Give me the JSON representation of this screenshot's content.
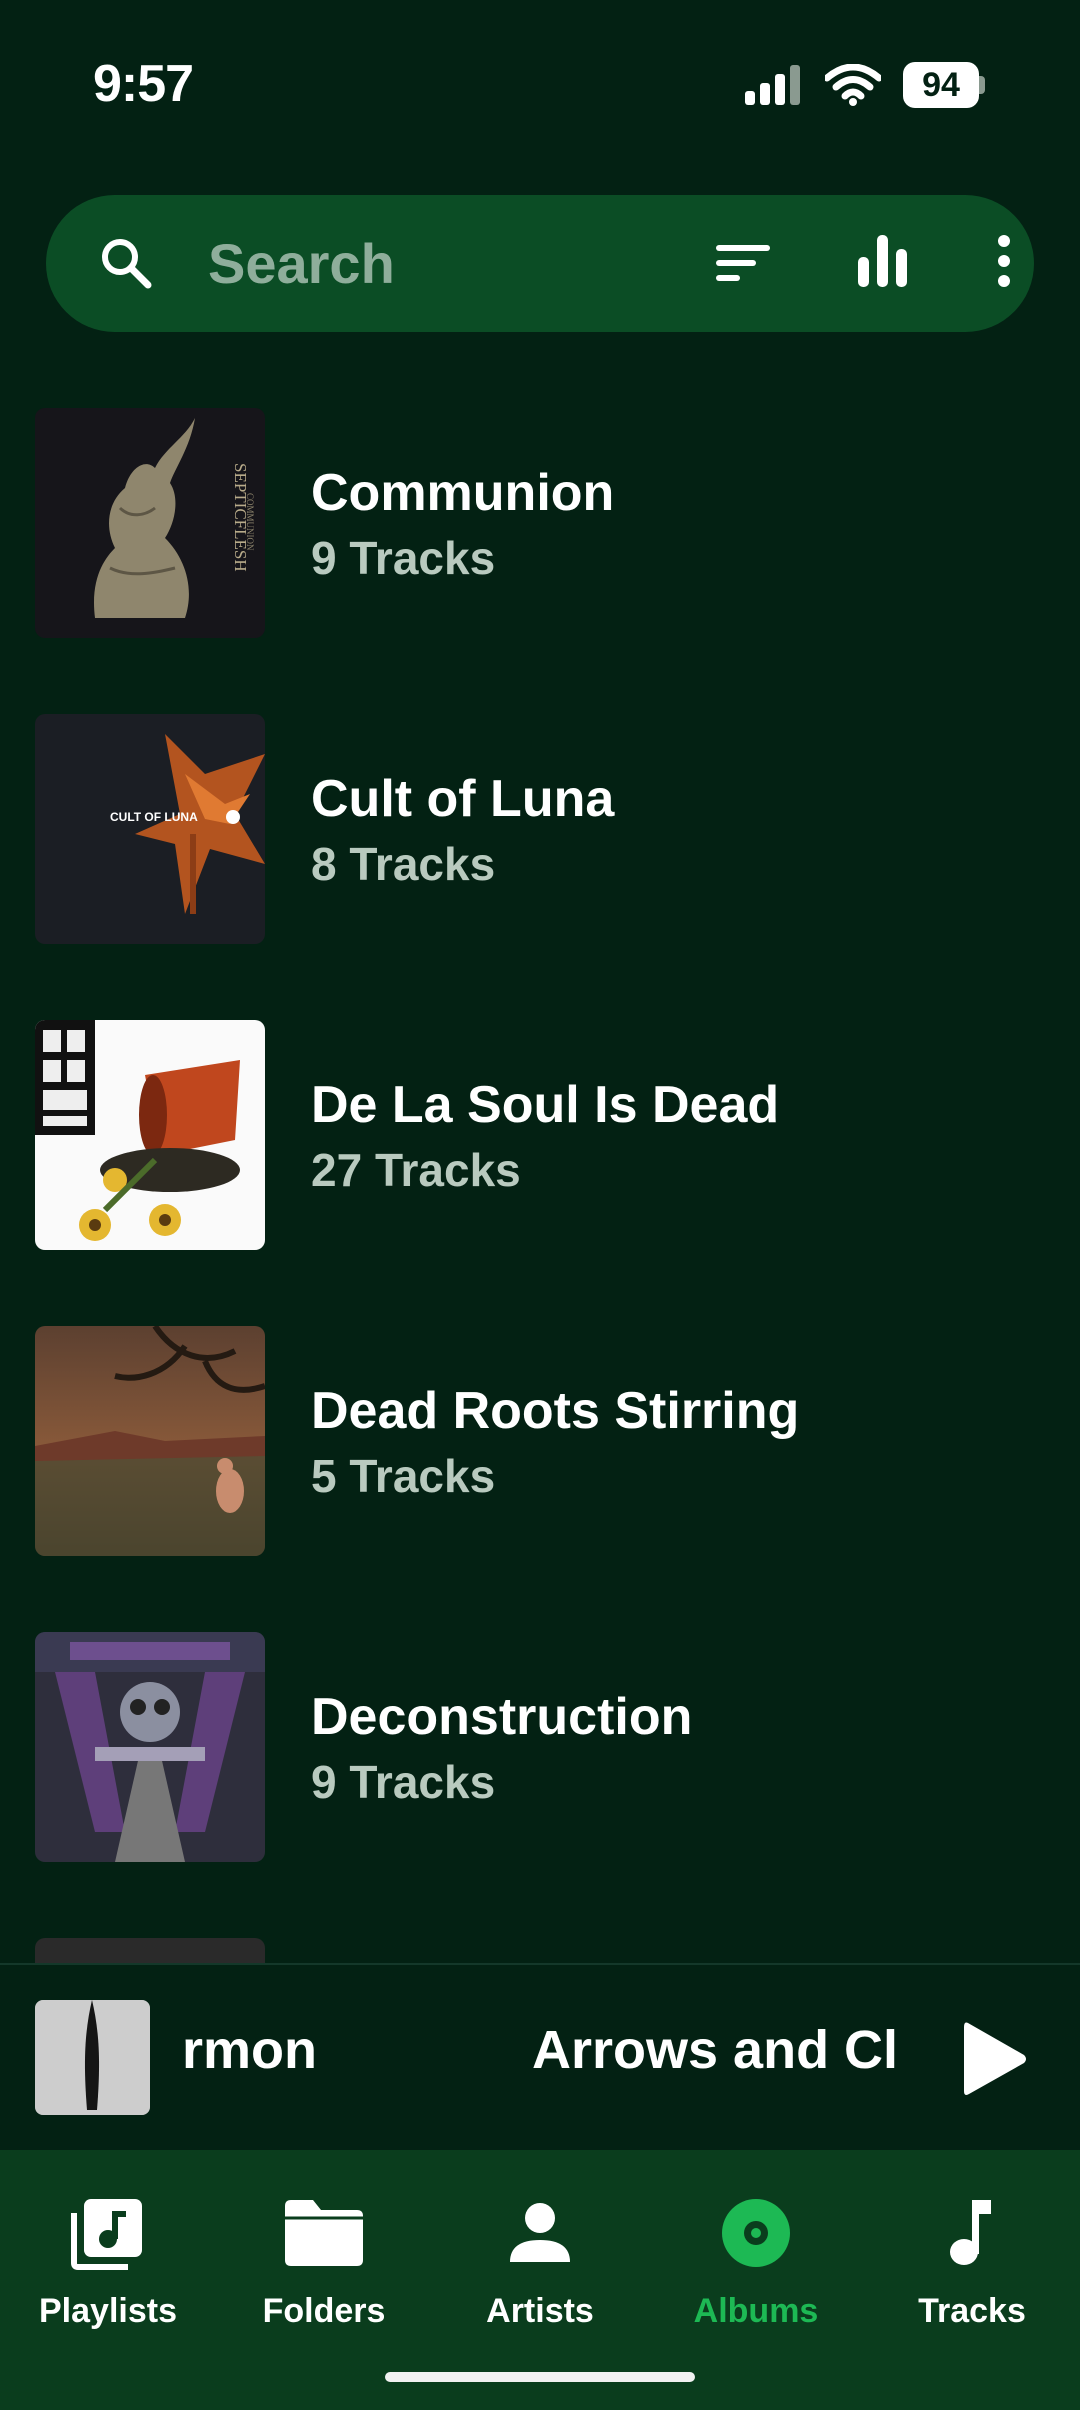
{
  "status_bar": {
    "time": "9:57",
    "battery": "94"
  },
  "search": {
    "placeholder": "Search",
    "icons": [
      "search-icon",
      "sort-icon",
      "equalizer-icon",
      "more-vert-icon"
    ]
  },
  "albums": [
    {
      "title": "Communion",
      "tracks": "9 Tracks"
    },
    {
      "title": "Cult of Luna",
      "tracks": "8 Tracks"
    },
    {
      "title": "De La Soul Is Dead",
      "tracks": "27 Tracks"
    },
    {
      "title": "Dead Roots Stirring",
      "tracks": "5 Tracks"
    },
    {
      "title": "Deconstruction",
      "tracks": "9 Tracks"
    }
  ],
  "album_art_text": {
    "communion": "SEPTICFLESH",
    "communion_sub": "COMMUNION",
    "cult_of_luna": "CULT OF LUNA"
  },
  "now_playing": {
    "title_fragment": "rmon",
    "title_next": "Arrows and Clay",
    "play_icon": "play-icon"
  },
  "nav": {
    "items": [
      {
        "label": "Playlists",
        "icon": "playlist-icon"
      },
      {
        "label": "Folders",
        "icon": "folder-icon"
      },
      {
        "label": "Artists",
        "icon": "person-icon"
      },
      {
        "label": "Albums",
        "icon": "album-icon"
      },
      {
        "label": "Tracks",
        "icon": "music-note-icon"
      }
    ],
    "active": "Albums"
  },
  "colors": {
    "background": "#032113",
    "search_bar": "#0b4d25",
    "nav_bar": "#0a3d1d",
    "accent": "#1db954",
    "secondary_text": "#b9cabf"
  }
}
